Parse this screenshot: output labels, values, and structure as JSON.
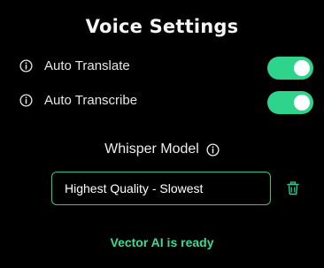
{
  "title": "Voice Settings",
  "settings": [
    {
      "label": "Auto Translate",
      "enabled": true,
      "info_icon": "info-circle-icon"
    },
    {
      "label": "Auto Transcribe",
      "enabled": true,
      "info_icon": "info-circle-icon"
    }
  ],
  "model": {
    "heading": "Whisper Model",
    "info_icon": "info-circle-icon",
    "selected": "Highest Quality - Slowest",
    "delete_icon": "trash-icon"
  },
  "status": "Vector AI is ready",
  "colors": {
    "accent": "#2ed48b",
    "status_text": "#3fd895",
    "background": "#000000"
  }
}
